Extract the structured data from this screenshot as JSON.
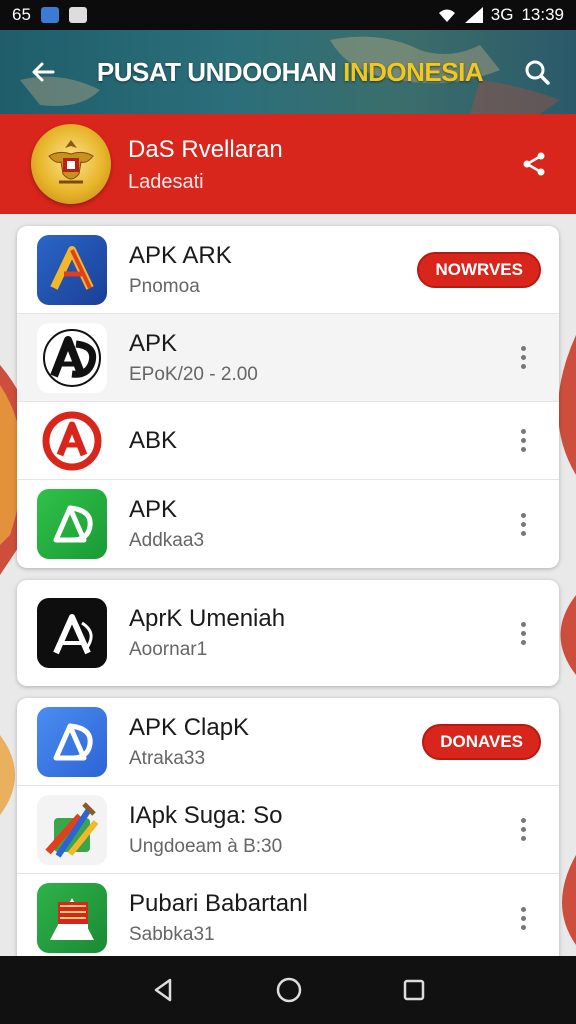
{
  "status_bar": {
    "left_text": "65",
    "time": "13:39",
    "network": "3G",
    "icons": [
      "notification-icon",
      "gallery-icon",
      "wifi-icon",
      "signal-icon"
    ]
  },
  "app_bar": {
    "title_main": "PUSAT UNDOOHAN",
    "title_accent": "INDONESIA",
    "icons": [
      "back-arrow-icon",
      "search-icon"
    ]
  },
  "profile": {
    "name": "DaS Rvellaran",
    "subtitle": "Ladesati",
    "icons": [
      "emblem-icon",
      "share-icon"
    ]
  },
  "cards": [
    {
      "rows": [
        {
          "title": "APK ARK",
          "subtitle": "Pnomoa",
          "action": "NOWRVES",
          "icon": "apk-a-blue-icon"
        },
        {
          "title": "APK",
          "subtitle": "EPoK/20 - 2.00",
          "action": null,
          "icon": "apk-a-black-icon"
        },
        {
          "title": "ABK",
          "subtitle": "",
          "action": null,
          "icon": "apk-a-red-icon"
        },
        {
          "title": "APK",
          "subtitle": "Addkaa3",
          "action": null,
          "icon": "apk-a-green-icon"
        }
      ]
    },
    {
      "rows": [
        {
          "title": "AprK Umeniah",
          "subtitle": "Aoornar1",
          "action": null,
          "icon": "apk-a-dark-icon"
        }
      ]
    },
    {
      "rows": [
        {
          "title": "APK ClapK",
          "subtitle": "Atraka33",
          "action": "DONAVES",
          "icon": "apk-a-lightblue-icon"
        },
        {
          "title": "IApk Suga: So",
          "subtitle": "Ungdoeam à B:30",
          "action": null,
          "icon": "paint-tools-icon"
        },
        {
          "title": "Pubari Babartanl",
          "subtitle": "Sabbka31",
          "action": null,
          "icon": "flag-book-icon"
        }
      ]
    }
  ],
  "nav": {
    "icons": [
      "nav-back-icon",
      "nav-home-icon",
      "nav-recents-icon"
    ]
  },
  "colors": {
    "primary_red": "#d9261c",
    "app_bar_teal": "#2b6f7a",
    "accent_yellow": "#f2c81d"
  }
}
